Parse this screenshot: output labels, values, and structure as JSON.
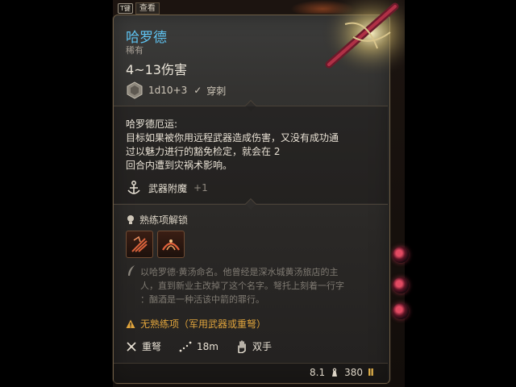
{
  "hotkey": {
    "key": "T键",
    "label": "查看"
  },
  "item": {
    "name": "哈罗德",
    "rarity": "稀有",
    "damage": "4~13伤害",
    "dice": "1d10+3",
    "damage_type": "穿刺"
  },
  "passive": {
    "title": "哈罗德厄运:",
    "lines": [
      "目标如果被你用远程武器造成伤害，又没有成功通",
      "过以魅力进行的豁免检定，就会在 2",
      "回合内遭到灾祸术影响。"
    ]
  },
  "enchantment": {
    "label": "武器附魔",
    "bonus": "+1"
  },
  "proficiency": {
    "header": "熟练项解锁"
  },
  "lore": {
    "lines": [
      "以哈罗德·黄汤命名。他曾经是深水城黄汤旅店的主",
      "人，直到新业主改掉了这个名字。弩托上刻着一行字",
      "：酗酒是一种活该中箭的罪行。"
    ]
  },
  "warning": "无熟练项（军用武器或重弩）",
  "properties": {
    "type": "重弩",
    "range": "18m",
    "handedness": "双手"
  },
  "footer": {
    "weight": "8.1",
    "value": "380"
  },
  "colors": {
    "title": "#5ec2f0",
    "warning": "#e0a43c",
    "border": "#6d5c44",
    "rune": "#e24a62"
  },
  "icons": [
    "dice-icon",
    "pierce-icon",
    "anchor-icon",
    "lightbulb-icon",
    "action-icon-1",
    "action-icon-2",
    "feather-icon",
    "warning-icon",
    "crossbow-icon",
    "range-icon",
    "hand-icon",
    "weight-icon",
    "coin-icon"
  ]
}
